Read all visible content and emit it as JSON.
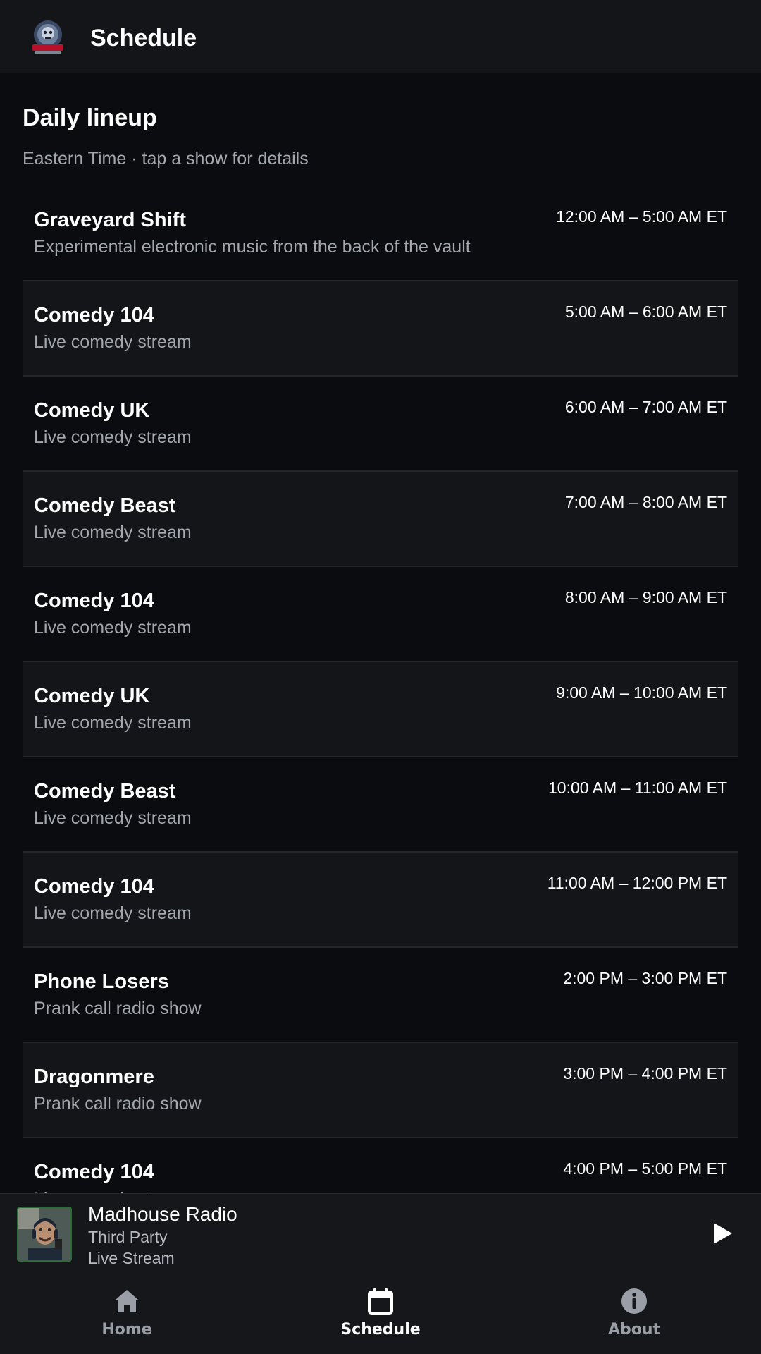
{
  "header": {
    "title": "Schedule",
    "logo_icon": "kaos-fm-logo"
  },
  "main": {
    "title": "Daily lineup",
    "subtitle": "Eastern Time · tap a show for details",
    "shows": [
      {
        "name": "Graveyard Shift",
        "desc": "Experimental electronic music from the back of the vault",
        "time": "12:00 AM – 5:00 AM ET"
      },
      {
        "name": "Comedy 104",
        "desc": "Live comedy stream",
        "time": "5:00 AM – 6:00 AM ET"
      },
      {
        "name": "Comedy UK",
        "desc": "Live comedy stream",
        "time": "6:00 AM – 7:00 AM ET"
      },
      {
        "name": "Comedy Beast",
        "desc": "Live comedy stream",
        "time": "7:00 AM – 8:00 AM ET"
      },
      {
        "name": "Comedy 104",
        "desc": "Live comedy stream",
        "time": "8:00 AM – 9:00 AM ET"
      },
      {
        "name": "Comedy UK",
        "desc": "Live comedy stream",
        "time": "9:00 AM – 10:00 AM ET"
      },
      {
        "name": "Comedy Beast",
        "desc": "Live comedy stream",
        "time": "10:00 AM – 11:00 AM ET"
      },
      {
        "name": "Comedy 104",
        "desc": "Live comedy stream",
        "time": "11:00 AM – 12:00 PM ET"
      },
      {
        "name": "Phone Losers",
        "desc": "Prank call radio show",
        "time": "2:00 PM – 3:00 PM ET"
      },
      {
        "name": "Dragonmere",
        "desc": "Prank call radio show",
        "time": "3:00 PM – 4:00 PM ET"
      },
      {
        "name": "Comedy 104",
        "desc": "Live comedy stream",
        "time": "4:00 PM – 5:00 PM ET"
      }
    ]
  },
  "player": {
    "title": "Madhouse Radio",
    "subtitle1": "Third Party",
    "subtitle2": "Live Stream",
    "artwork_icon": "host-avatar",
    "action_icon": "play-icon"
  },
  "nav": {
    "items": [
      {
        "label": "Home",
        "icon": "home-icon",
        "active": false
      },
      {
        "label": "Schedule",
        "icon": "calendar-icon",
        "active": true
      },
      {
        "label": "About",
        "icon": "info-icon",
        "active": false
      }
    ]
  },
  "colors": {
    "background": "#0b0c0f",
    "surface": "#141519",
    "muted_text": "#a3a7ae",
    "inactive_nav": "#9a9ea6"
  }
}
